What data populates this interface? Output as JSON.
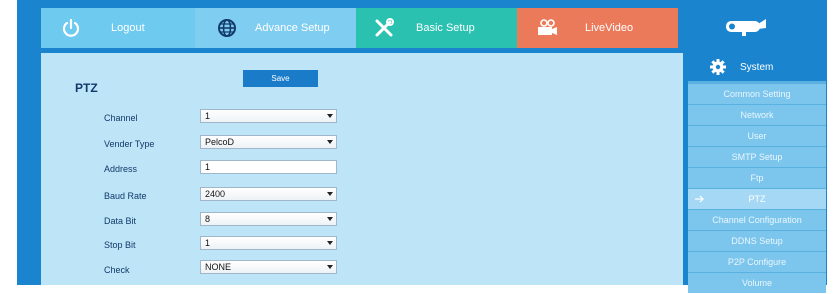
{
  "nav": {
    "items": [
      {
        "key": "logout",
        "label": "Logout",
        "icon": "power-icon"
      },
      {
        "key": "advance",
        "label": "Advance Setup",
        "icon": "globe-icon"
      },
      {
        "key": "basic",
        "label": "Basic Setup",
        "icon": "tools-icon"
      },
      {
        "key": "live",
        "label": "LiveVideo",
        "icon": "video-camera-icon"
      }
    ],
    "logo_icon": "camera-logo-icon"
  },
  "panel": {
    "title": "PTZ",
    "save_label": "Save",
    "fields": [
      {
        "label": "Channel",
        "type": "select",
        "value": "1"
      },
      {
        "label": "Vender Type",
        "type": "select",
        "value": "PelcoD"
      },
      {
        "label": "Address",
        "type": "input",
        "value": "1"
      },
      {
        "label": "Baud Rate",
        "type": "select",
        "value": "2400"
      },
      {
        "label": "Data Bit",
        "type": "select",
        "value": "8"
      },
      {
        "label": "Stop Bit",
        "type": "select",
        "value": "1"
      },
      {
        "label": "Check",
        "type": "select",
        "value": "NONE"
      }
    ]
  },
  "sidebar": {
    "header": "System",
    "items": [
      {
        "label": "Common Setting",
        "active": false
      },
      {
        "label": "Network",
        "active": false
      },
      {
        "label": "User",
        "active": false
      },
      {
        "label": "SMTP Setup",
        "active": false
      },
      {
        "label": "Ftp",
        "active": false
      },
      {
        "label": "PTZ",
        "active": true
      },
      {
        "label": "Channel Configuration",
        "active": false
      },
      {
        "label": "DDNS Setup",
        "active": false
      },
      {
        "label": "P2P Configure",
        "active": false
      },
      {
        "label": "Volume",
        "active": false
      }
    ]
  },
  "colors": {
    "accent": "#1a84cf",
    "logout": "#6fcaf0",
    "advance": "#7fcdf1",
    "basic": "#2ac1b1",
    "live": "#eb7a5a",
    "panel_bg": "#bee4f7"
  }
}
